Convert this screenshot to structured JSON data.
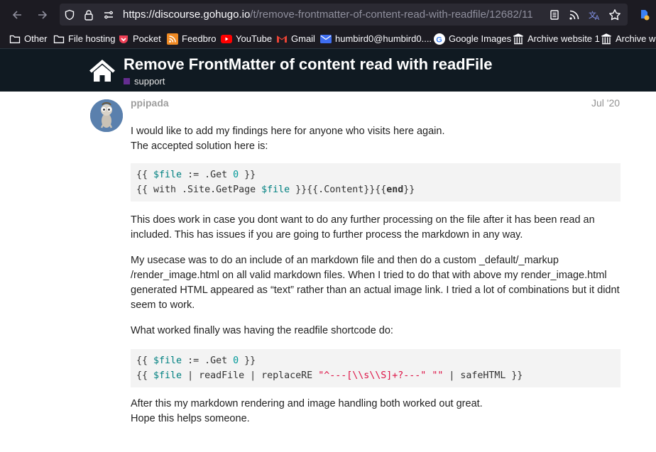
{
  "browser": {
    "url_host": "https://discourse.gohugo.io",
    "url_path": "/t/remove-frontmatter-of-content-read-with-readfile/12682/11",
    "bookmarks": [
      {
        "label": "Other",
        "icon": "folder-icon"
      },
      {
        "label": "File hosting",
        "icon": "folder-icon"
      },
      {
        "label": "Pocket",
        "icon": "pocket-icon"
      },
      {
        "label": "Feedbro",
        "icon": "rss-icon"
      },
      {
        "label": "YouTube",
        "icon": "youtube-icon"
      },
      {
        "label": "Gmail",
        "icon": "gmail-icon"
      },
      {
        "label": "humbird0@humbird0....",
        "icon": "mail-icon"
      },
      {
        "label": "Google Images",
        "icon": "google-icon"
      },
      {
        "label": "Archive website 1",
        "icon": "archive-icon"
      },
      {
        "label": "Archive we",
        "icon": "archive-icon"
      }
    ]
  },
  "header": {
    "title": "Remove FrontMatter of content read with readFile",
    "category": "support",
    "category_color": "#652d90"
  },
  "post": {
    "username": "ppipada",
    "date": "Jul '20",
    "p1_line1": "I would like to add my findings here for anyone who visits here again.",
    "p1_line2": "The accepted solution here is:",
    "code1": {
      "l1": [
        "{{ ",
        "$file",
        " := .Get ",
        "0",
        " }}"
      ],
      "l2": [
        "{{ with .Site.GetPage ",
        "$file",
        " }}{{.Content}}{{",
        "end",
        "}}"
      ]
    },
    "p2": "This does work in case you dont want to do any further processing on the file after it has been read an included. This has issues if you are going to further process the markdown in any way.",
    "p3": "My usecase was to do an include of an markdown file and then do a custom _default/_markup /render_image.html on all valid markdown files. When I tried to do that with above my render_image.html generated HTML appeared as “text” rather than an actual image link. I tried a lot of combinations but it didnt seem to work.",
    "p4": "What worked finally was having the readfile shortcode do:",
    "code2": {
      "l1": [
        "{{ ",
        "$file",
        " := .Get ",
        "0",
        " }}"
      ],
      "l2": [
        "{{ ",
        "$file",
        " | readFile | replaceRE ",
        "\"^---[\\\\s\\\\S]+?---\"",
        " ",
        "\"\"",
        " | safeHTML }}"
      ]
    },
    "p5_line1": "After this my markdown rendering and image handling both worked out great.",
    "p5_line2": "Hope this helps someone."
  }
}
